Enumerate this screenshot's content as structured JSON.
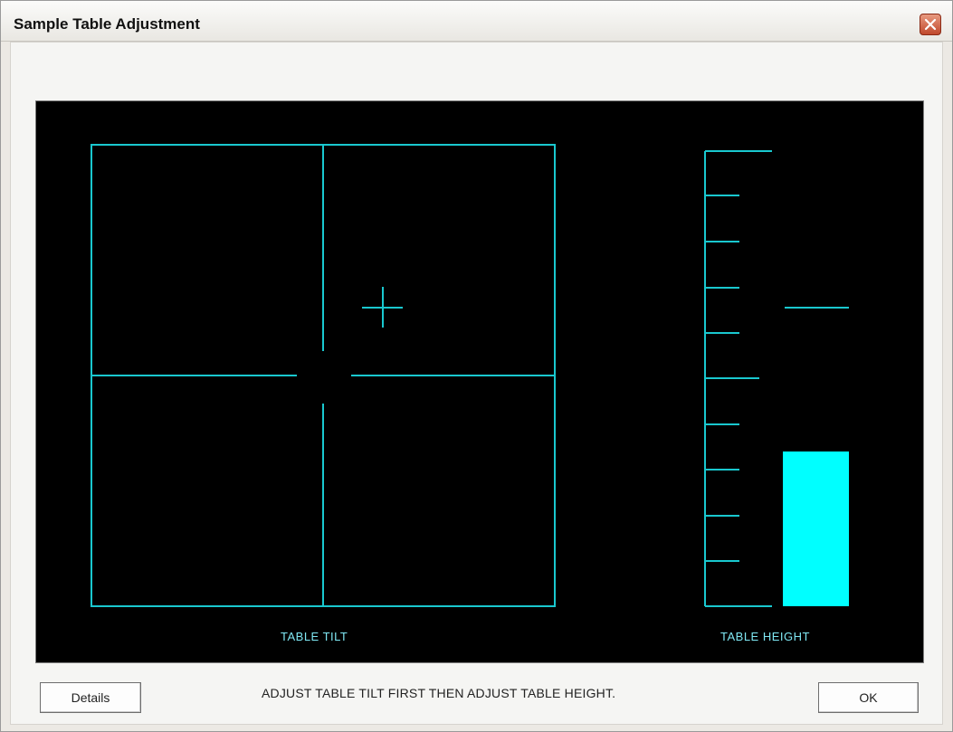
{
  "window": {
    "title": "Sample Table Adjustment"
  },
  "display": {
    "tilt_label": "TABLE TILT",
    "height_label": "TABLE HEIGHT",
    "accent_color": "#00ffff",
    "tilt_tick_count": 10,
    "height_level_fraction": 0.34
  },
  "footer": {
    "details_label": "Details",
    "instruction": "ADJUST TABLE TILT  FIRST  THEN ADJUST TABLE HEIGHT.",
    "ok_label": "OK"
  },
  "icons": {
    "close": "close-icon"
  }
}
